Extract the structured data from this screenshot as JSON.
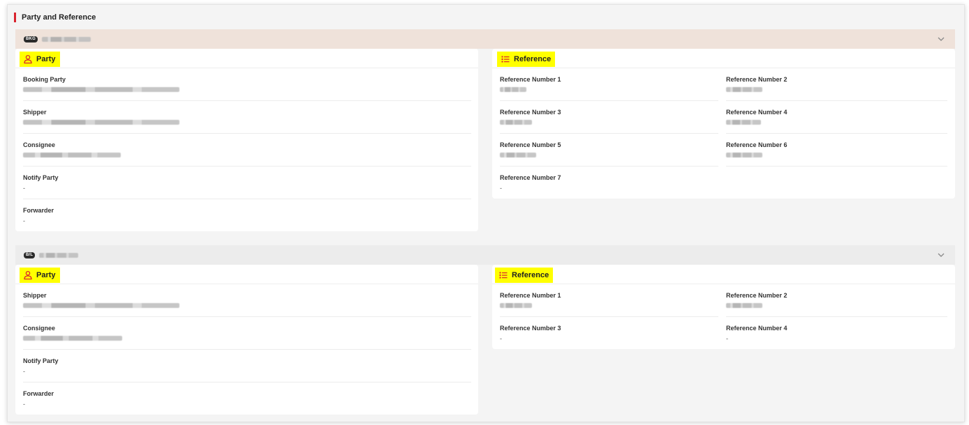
{
  "section_title": "Party and Reference",
  "colors": {
    "accent": "#d9232e",
    "highlight": "#ffff00",
    "bkg_header": "#efe2da",
    "bl_header": "#ececec",
    "icon": "#d9232e"
  },
  "groups": [
    {
      "tag": "BKG",
      "party": {
        "label": "Party",
        "icon": "people-icon",
        "fields": [
          {
            "label": "Booking Party",
            "value": ""
          },
          {
            "label": "Shipper",
            "value": ""
          },
          {
            "label": "Consignee",
            "value": ""
          },
          {
            "label": "Notify Party",
            "value": "-"
          },
          {
            "label": "Forwarder",
            "value": "-"
          }
        ]
      },
      "reference": {
        "label": "Reference",
        "icon": "list-icon",
        "fields": [
          {
            "label": "Reference Number 1",
            "value": ""
          },
          {
            "label": "Reference Number 2",
            "value": ""
          },
          {
            "label": "Reference Number 3",
            "value": ""
          },
          {
            "label": "Reference Number 4",
            "value": ""
          },
          {
            "label": "Reference Number 5",
            "value": ""
          },
          {
            "label": "Reference Number 6",
            "value": ""
          },
          {
            "label": "Reference Number 7",
            "value": "-"
          }
        ]
      }
    },
    {
      "tag": "B/L",
      "party": {
        "label": "Party",
        "icon": "people-icon",
        "fields": [
          {
            "label": "Shipper",
            "value": ""
          },
          {
            "label": "Consignee",
            "value": ""
          },
          {
            "label": "Notify Party",
            "value": "-"
          },
          {
            "label": "Forwarder",
            "value": "-"
          }
        ]
      },
      "reference": {
        "label": "Reference",
        "icon": "list-icon",
        "fields": [
          {
            "label": "Reference Number 1",
            "value": ""
          },
          {
            "label": "Reference Number 2",
            "value": ""
          },
          {
            "label": "Reference Number 3",
            "value": "-"
          },
          {
            "label": "Reference Number 4",
            "value": "-"
          }
        ]
      }
    }
  ]
}
